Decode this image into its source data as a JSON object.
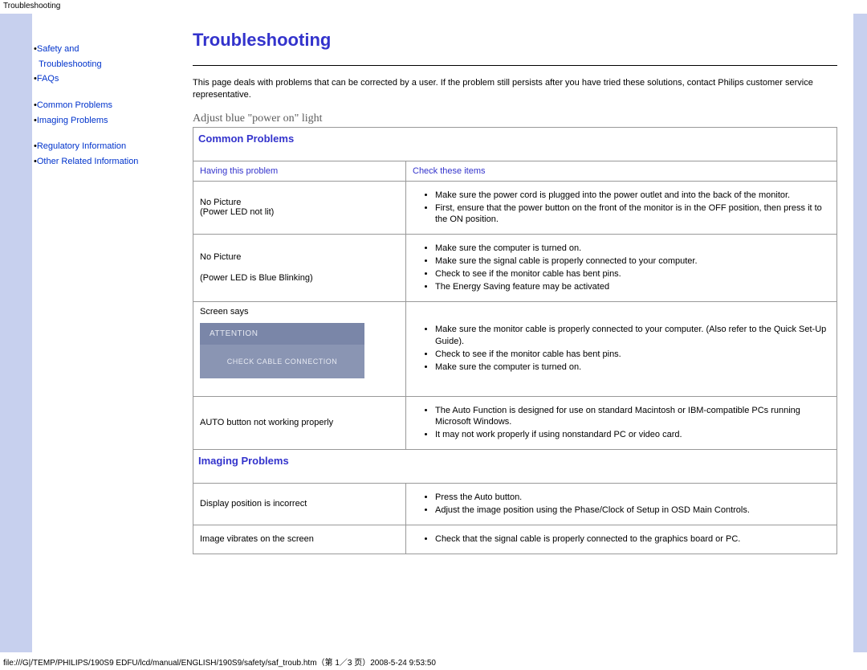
{
  "topLabel": "Troubleshooting",
  "sidebar": {
    "items": [
      {
        "text1": "Safety and",
        "text2": "Troubleshooting"
      },
      {
        "text1": "FAQs"
      },
      {
        "text1": "Common Problems"
      },
      {
        "text1": "Imaging Problems"
      },
      {
        "text1": "Regulatory Information"
      },
      {
        "text1": "Other Related Information"
      }
    ]
  },
  "page": {
    "title": "Troubleshooting",
    "intro": "This page deals with problems that can be corrected by a user. If the problem still persists after you have tried these solutions, contact Philips customer service representative.",
    "adjust": "Adjust blue \"power on\" light"
  },
  "sections": {
    "common": {
      "header": "Common Problems",
      "colLeft": "Having this problem",
      "colRight": "Check these items",
      "rows": [
        {
          "problem_l1": "No Picture",
          "problem_l2": "(Power LED not lit)",
          "checks": [
            "Make sure the power cord is plugged into the power outlet and into the back of the monitor.",
            "First, ensure that the power button on the front of the monitor is in the OFF position, then press it to the ON position."
          ]
        },
        {
          "problem_l1": "No Picture",
          "problem_l2": "(Power LED is Blue Blinking)",
          "checks": [
            "Make sure the computer is turned on.",
            "Make sure the signal cable is properly connected to your computer.",
            "Check to see if the monitor cable has bent pins.",
            "The Energy Saving feature may be activated"
          ]
        },
        {
          "problem_l1": "Screen says",
          "attention_top": "ATTENTION",
          "attention_bot": "CHECK CABLE CONNECTION",
          "checks": [
            "Make sure the monitor cable is properly connected to your computer. (Also refer to the Quick Set-Up Guide).",
            "Check to see if the monitor cable has bent pins.",
            "Make sure the computer is turned on."
          ]
        },
        {
          "problem_l1": "AUTO button not working properly",
          "checks": [
            "The Auto Function is designed for use on standard Macintosh or IBM-compatible PCs running Microsoft Windows.",
            "It may not work properly if using nonstandard PC or video card."
          ]
        }
      ]
    },
    "imaging": {
      "header": "Imaging Problems",
      "rows": [
        {
          "problem_l1": "Display position is incorrect",
          "checks": [
            "Press the Auto button.",
            "Adjust the image position using the Phase/Clock of Setup in OSD Main Controls."
          ]
        },
        {
          "problem_l1": "Image vibrates on the screen",
          "checks": [
            "Check that the signal cable is properly connected to the graphics board or PC."
          ]
        }
      ]
    }
  },
  "footer": "file:///G|/TEMP/PHILIPS/190S9 EDFU/lcd/manual/ENGLISH/190S9/safety/saf_troub.htm（第 1／3 页）2008-5-24 9:53:50"
}
